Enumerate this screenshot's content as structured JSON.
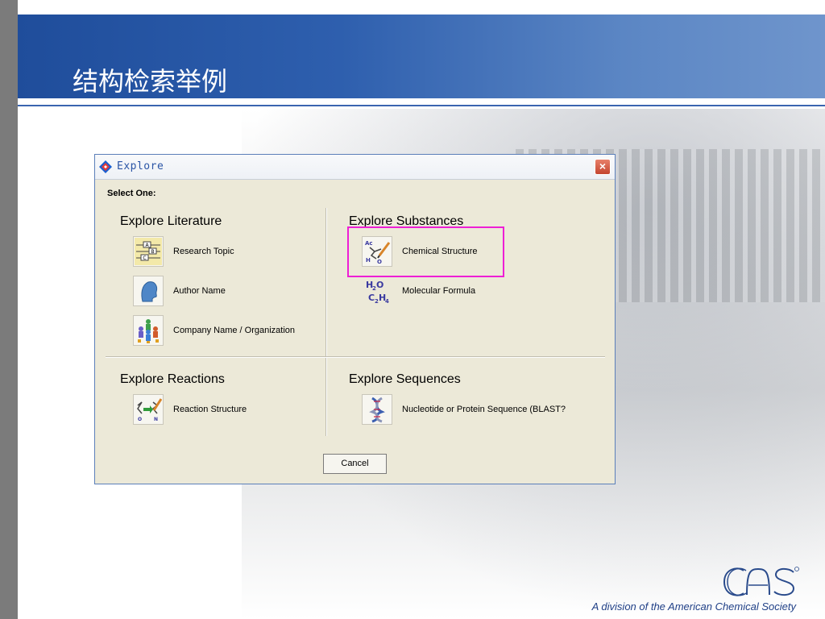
{
  "slide": {
    "title": "结构检索举例",
    "footer": "A division of the American Chemical Society"
  },
  "dialog": {
    "title": "Explore",
    "close_label": "×",
    "select_one": "Select One:",
    "cancel_label": "Cancel",
    "sections": {
      "literature": {
        "title": "Explore Literature",
        "items": [
          {
            "label": "Research Topic",
            "icon": "research-topic-icon"
          },
          {
            "label": "Author Name",
            "icon": "author-head-icon"
          },
          {
            "label": "Company Name / Organization",
            "icon": "organization-people-icon"
          }
        ]
      },
      "substances": {
        "title": "Explore Substances",
        "items": [
          {
            "label": "Chemical Structure",
            "icon": "chemical-structure-icon"
          },
          {
            "label": "Molecular Formula",
            "icon": "molecular-formula-icon"
          }
        ]
      },
      "reactions": {
        "title": "Explore Reactions",
        "items": [
          {
            "label": "Reaction Structure",
            "icon": "reaction-structure-icon"
          }
        ]
      },
      "sequences": {
        "title": "Explore Sequences",
        "items": [
          {
            "label": "Nucleotide or Protein Sequence (BLAST?",
            "icon": "dna-helix-icon"
          }
        ]
      }
    }
  },
  "colors": {
    "header_blue": "#1f4d9b",
    "highlight": "#ee1fd5",
    "dialog_bg": "#ece9d8"
  }
}
